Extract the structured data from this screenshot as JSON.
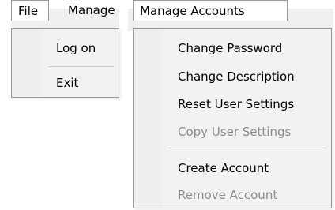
{
  "left_menu": {
    "menubar_items": [
      "File",
      "Manage"
    ],
    "dropdown_items": [
      {
        "label": "Log on",
        "enabled": true
      },
      {
        "label": "Exit",
        "enabled": true
      }
    ]
  },
  "right_menu": {
    "menubar_title": "Manage Accounts",
    "dropdown_items": [
      {
        "label": "Change Password",
        "enabled": true
      },
      {
        "label": "Change Description",
        "enabled": true
      },
      {
        "label": "Reset User Settings",
        "enabled": true
      },
      {
        "label": "Copy User Settings",
        "enabled": false
      },
      {
        "label": "Create Account",
        "enabled": true
      },
      {
        "label": "Remove Account",
        "enabled": false
      }
    ]
  },
  "colors": {
    "disabled_text": "#8c8c8c",
    "menu_background": "#f2f2f2",
    "border": "#999999"
  }
}
